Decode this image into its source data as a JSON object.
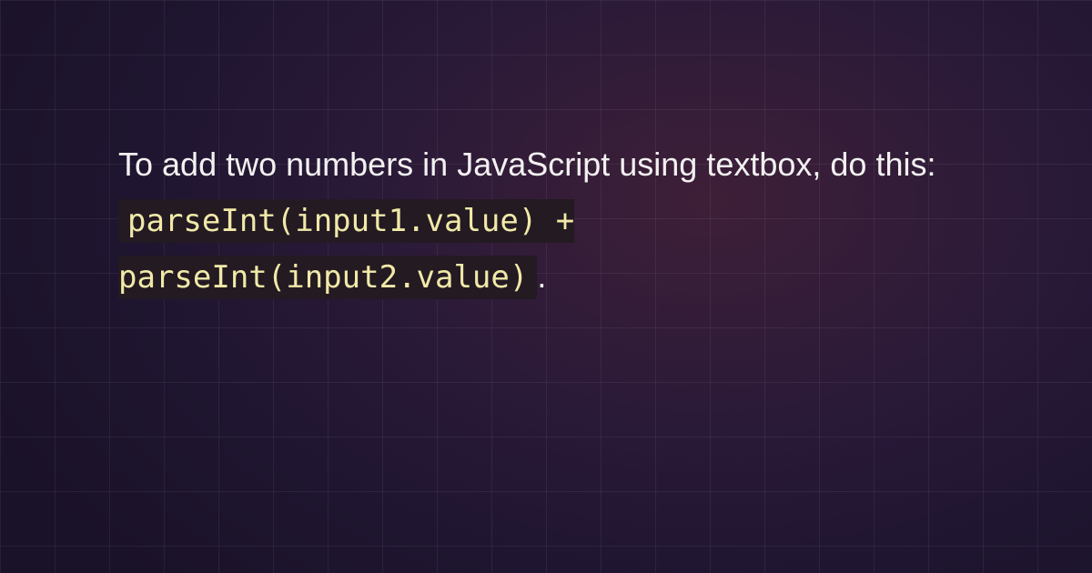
{
  "intro": "To add two numbers in JavaScript using textbox, do this: ",
  "code": "parseInt(input1.value) + parseInt(input2.value)",
  "period": "."
}
